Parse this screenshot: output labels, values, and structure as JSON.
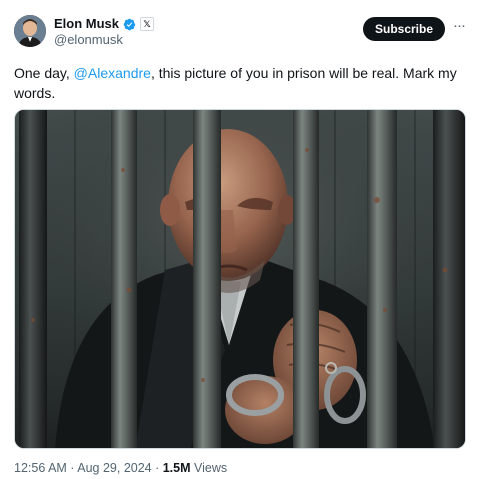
{
  "author": {
    "name": "Elon Musk",
    "handle": "@elonmusk",
    "badge_icon": "verified-check-icon",
    "affiliation_icon": "x-logo-icon",
    "affiliation_glyph": "𝕏"
  },
  "actions": {
    "subscribe_label": "Subscribe",
    "more_glyph": "···"
  },
  "tweet": {
    "text_before": "One day, ",
    "mention": "@Alexandre",
    "text_after": ", this picture of you in prison will be real. Mark my words."
  },
  "meta": {
    "time": "12:56 AM",
    "separator": " · ",
    "date": "Aug 29, 2024",
    "views_count": "1.5M",
    "views_label": " Views"
  },
  "colors": {
    "accent": "#1d9bf0",
    "text": "#0f1419",
    "secondary": "#536471",
    "button": "#0f1419"
  }
}
